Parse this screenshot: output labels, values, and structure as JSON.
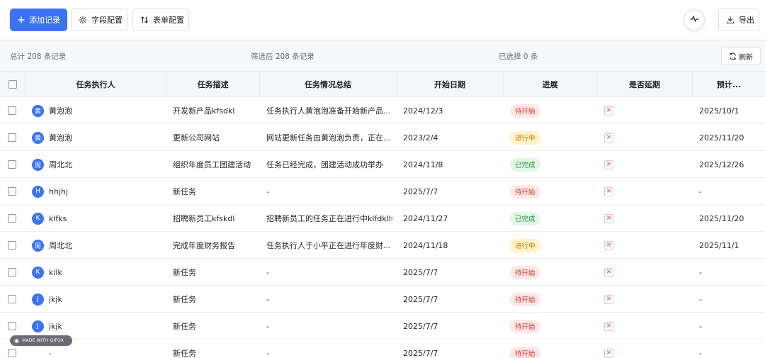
{
  "toolbar": {
    "add_label": "添加记录",
    "field_config_label": "字段配置",
    "form_config_label": "表单配置",
    "export_label": "导出"
  },
  "stats": {
    "total": "总计 208 条记录",
    "filtered": "筛选后 208 条记录",
    "selected": "已选择 0 条",
    "refresh_label": "刷新"
  },
  "columns": [
    "任务执行人",
    "任务描述",
    "任务情况总结",
    "开始日期",
    "进展",
    "是否延期",
    "预计..."
  ],
  "rows": [
    {
      "avatar": "黄",
      "name": "黄泡泡",
      "desc": "开发新产品kfsdkl",
      "summary": "任务执行人黄泡泡准备开始新产品...",
      "start": "2024/12/3",
      "status": "待开始",
      "tone": "red",
      "due": "2025/10/1"
    },
    {
      "avatar": "黄",
      "name": "黄泡泡",
      "desc": "更新公司网站",
      "summary": "网站更新任务由黄泡泡负责，正在...",
      "start": "2023/2/4",
      "status": "进行中",
      "tone": "yellow",
      "due": "2025/11/20"
    },
    {
      "avatar": "周",
      "name": "周北北",
      "desc": "组织年度员工团建活动",
      "summary": "任务已经完成，团建活动成功举办",
      "start": "2024/11/8",
      "status": "已完成",
      "tone": "green",
      "due": "2025/12/26"
    },
    {
      "avatar": "H",
      "name": "hhjhj",
      "desc": "新任务",
      "summary": "-",
      "start": "2025/7/7",
      "status": "待开始",
      "tone": "red",
      "due": "-"
    },
    {
      "avatar": "K",
      "name": "klfks",
      "desc": "招聘新员工kfskdl",
      "summary": "招聘新员工的任务正在进行中klfdklls",
      "start": "2024/11/27",
      "status": "已完成",
      "tone": "green",
      "due": "2025/11/20"
    },
    {
      "avatar": "周",
      "name": "周北北",
      "desc": "完成年度财务报告",
      "summary": "任务执行人于小平正在进行年度财...",
      "start": "2024/11/18",
      "status": "进行中",
      "tone": "yellow",
      "due": "2025/11/1"
    },
    {
      "avatar": "K",
      "name": "kilk",
      "desc": "新任务",
      "summary": "-",
      "start": "2025/7/7",
      "status": "待开始",
      "tone": "red",
      "due": "-"
    },
    {
      "avatar": "J",
      "name": "jkjk",
      "desc": "新任务",
      "summary": "-",
      "start": "2025/7/7",
      "status": "待开始",
      "tone": "red",
      "due": "-"
    },
    {
      "avatar": "J",
      "name": "jkjk",
      "desc": "新任务",
      "summary": "-",
      "start": "2025/7/7",
      "status": "待开始",
      "tone": "red",
      "due": "-"
    },
    {
      "avatar": "",
      "name": "-",
      "desc": "新任务",
      "summary": "-",
      "start": "2025/7/7",
      "status": "待开始",
      "tone": "red",
      "due": "-"
    }
  ],
  "watermark": "MADE WITH GIFOX",
  "colors": {
    "primary": "#3c73f0",
    "pending": "#d93026",
    "in_progress": "#c07a00",
    "done": "#1f8a43"
  }
}
